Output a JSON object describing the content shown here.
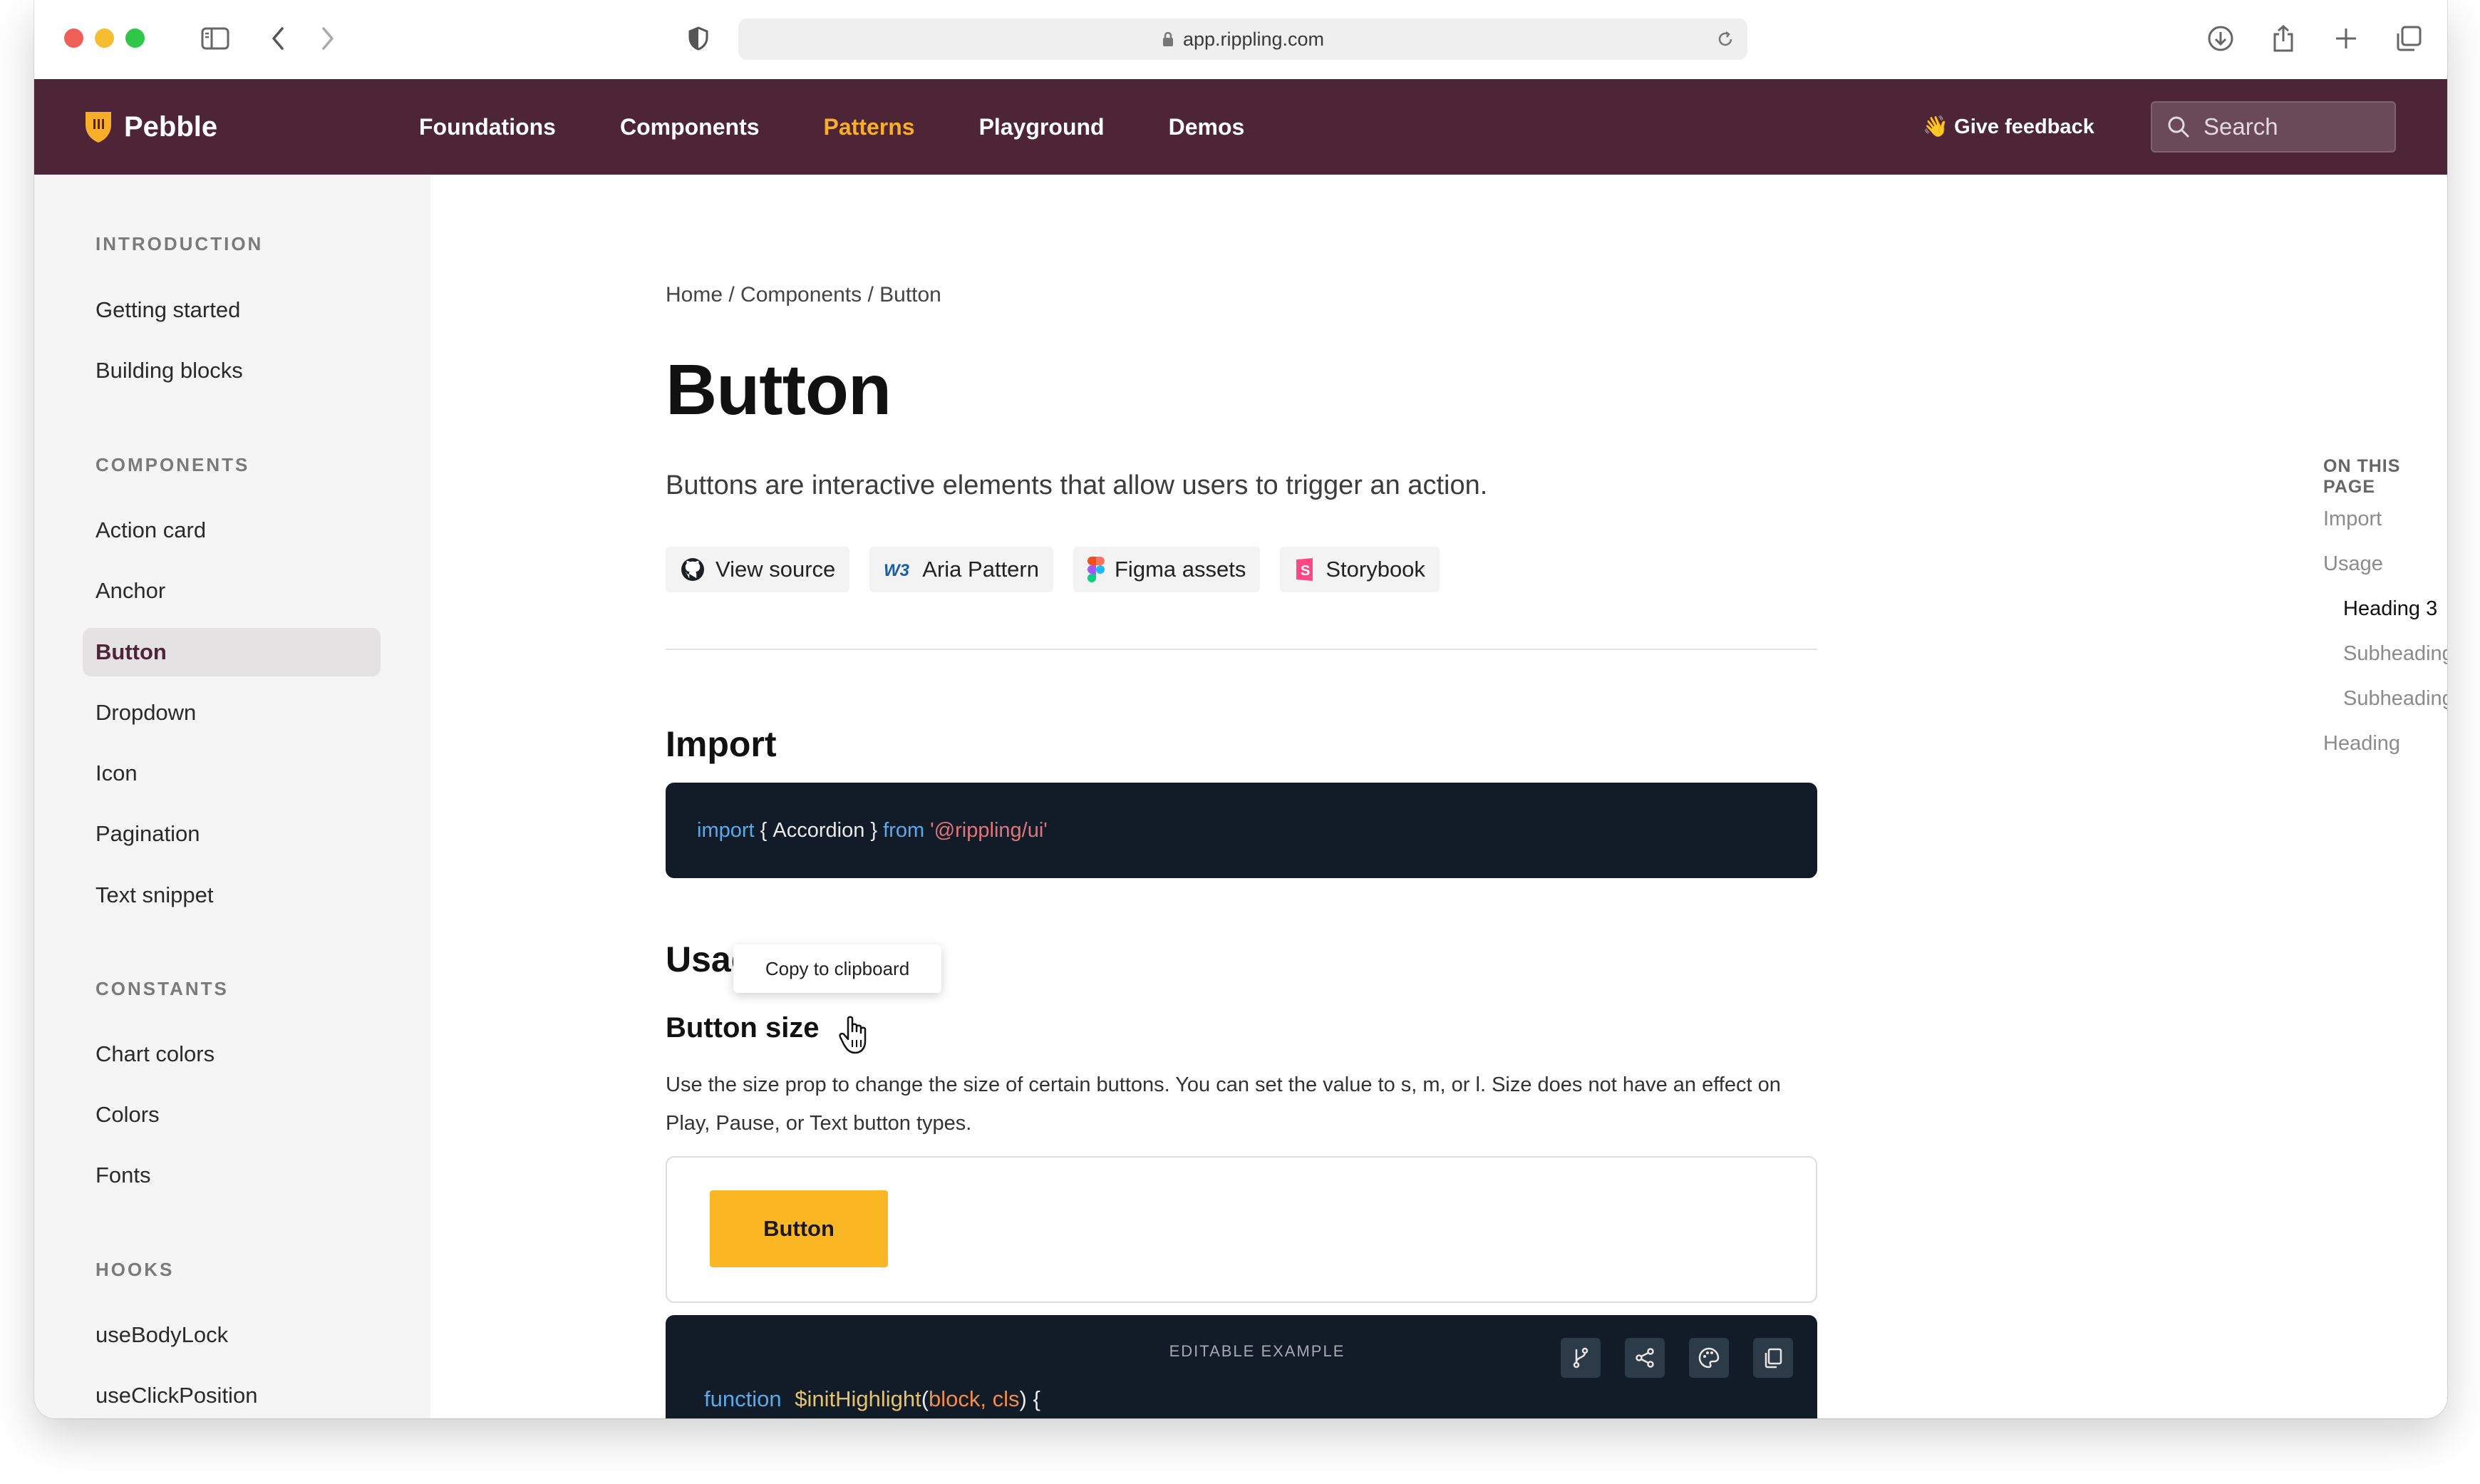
{
  "browser": {
    "url": "app.rippling.com"
  },
  "brand": {
    "name": "Pebble",
    "logo_color": "#f9ae2a"
  },
  "topnav": {
    "links": [
      "Foundations",
      "Components",
      "Patterns",
      "Playground",
      "Demos"
    ],
    "active": "Patterns",
    "feedback": "👋 Give feedback",
    "search_placeholder": "Search",
    "bg_color": "#4d2536",
    "accent_color": "#f9ae2a"
  },
  "sidebar": {
    "sections": [
      {
        "heading": "INTRODUCTION",
        "items": [
          "Getting started",
          "Building blocks"
        ]
      },
      {
        "heading": "COMPONENTS",
        "items": [
          "Action card",
          "Anchor",
          "Button",
          "Dropdown",
          "Icon",
          "Pagination",
          "Text snippet"
        ]
      },
      {
        "heading": "CONSTANTS",
        "items": [
          "Chart colors",
          "Colors",
          "Fonts"
        ]
      },
      {
        "heading": "HOOKS",
        "items": [
          "useBodyLock",
          "useClickPosition"
        ]
      }
    ],
    "active_item": "Button"
  },
  "main": {
    "breadcrumb": "Home / Components / Button",
    "title": "Button",
    "lead": "Buttons are interactive elements that allow users to trigger an action.",
    "chips": [
      "View source",
      "Aria Pattern",
      "Figma assets",
      "Storybook"
    ],
    "import_heading": "Import",
    "import_code": {
      "kw1": "import",
      "brace_open": " { ",
      "name": "Accordion",
      "brace_close": " } ",
      "kw2": "from",
      "module": "'@rippling/ui'"
    },
    "usage_heading": "Usage",
    "tooltip": "Copy to clipboard",
    "size_heading": "Button size",
    "size_desc": "Use the size prop to change the size of certain buttons. You can set the value to s, m, or l. Size does not have an effect on Play, Pause, or Text button types.",
    "demo_button": "Button",
    "editor_label": "EDITABLE EXAMPLE",
    "editor_code": {
      "kw": "function",
      "fn": "$initHighlight",
      "open": "(",
      "args": "block, cls",
      "close": ") {"
    }
  },
  "toc": {
    "heading": "ON THIS PAGE",
    "items": [
      "Import",
      "Usage",
      "Heading 3",
      "Subheading",
      "Subheading",
      "Heading"
    ],
    "active": "Heading 3"
  }
}
